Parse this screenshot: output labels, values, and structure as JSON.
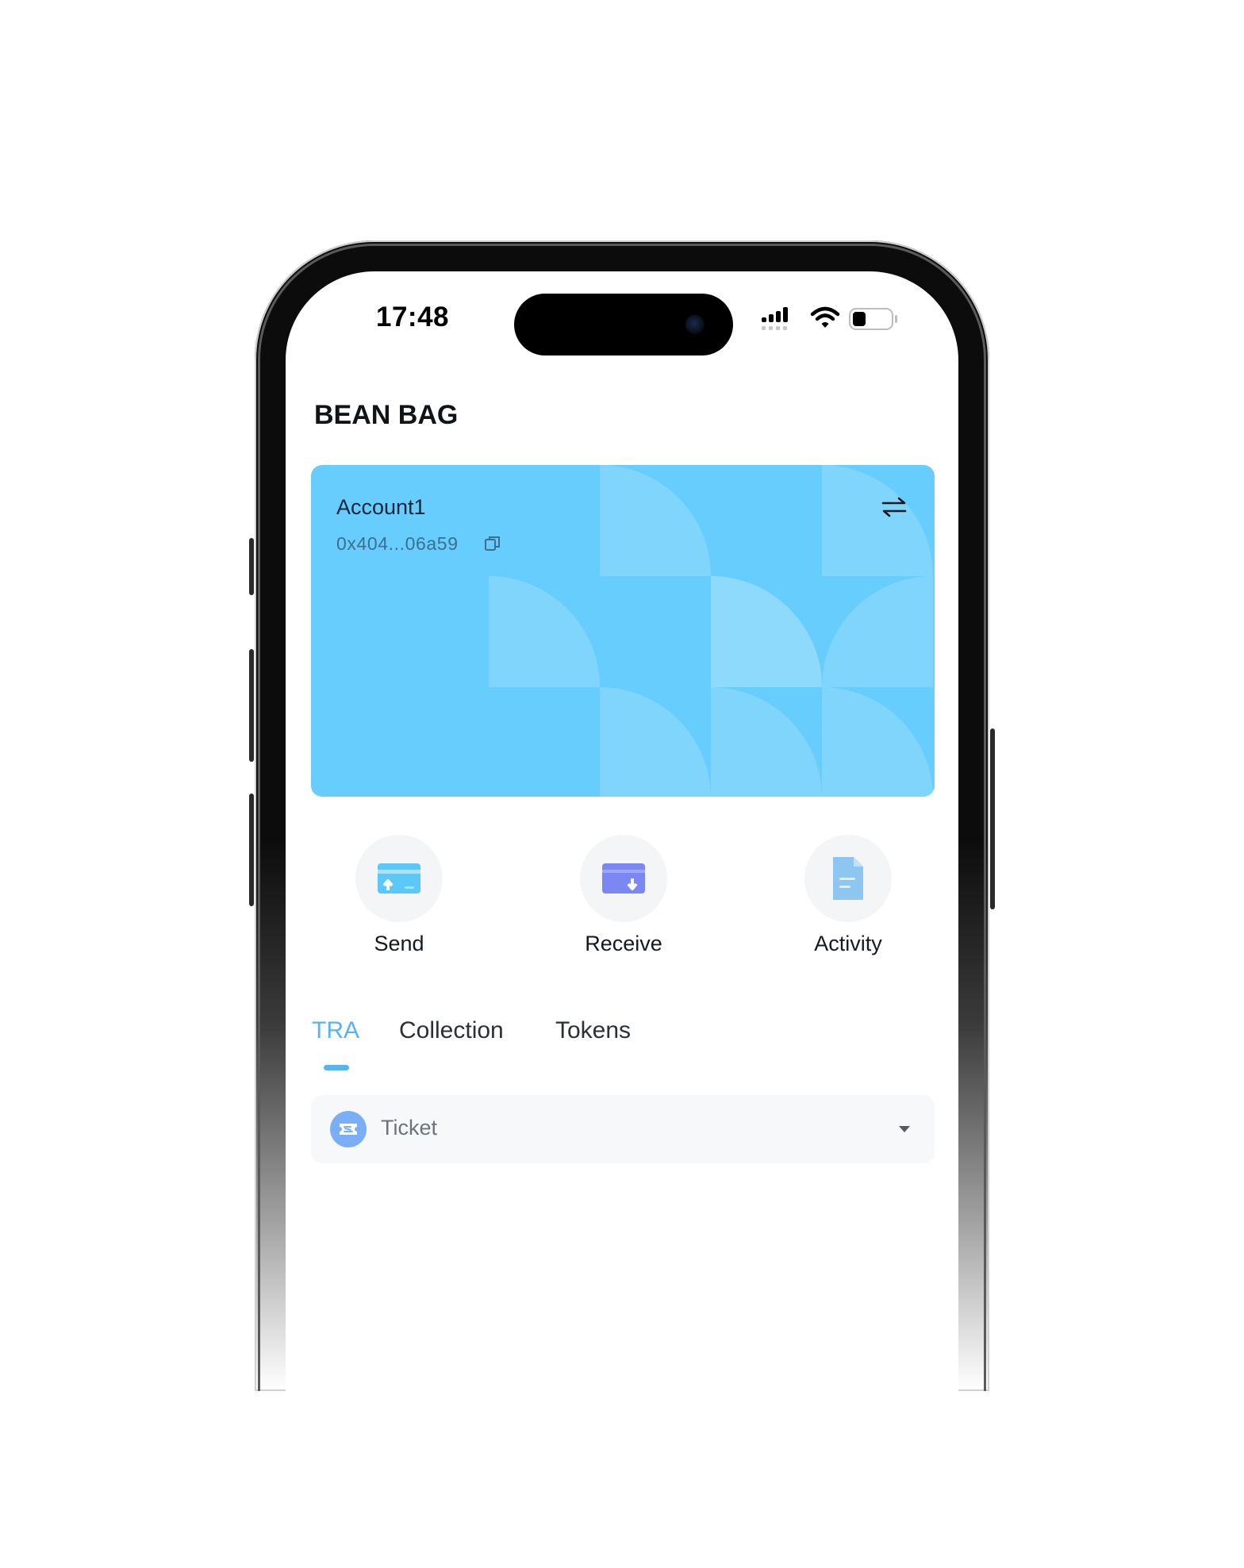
{
  "status_bar": {
    "time": "17:48"
  },
  "app": {
    "title": "BEAN BAG"
  },
  "account_card": {
    "name": "Account1",
    "address": "0x404...06a59",
    "background_color": "#66cdfd"
  },
  "actions": [
    {
      "label": "Send",
      "icon": "send-card-icon",
      "color": "#5cc8f7"
    },
    {
      "label": "Receive",
      "icon": "receive-card-icon",
      "color": "#7b88f3"
    },
    {
      "label": "Activity",
      "icon": "document-icon",
      "color": "#8ec6f2"
    }
  ],
  "tabs": [
    {
      "label": "TRA",
      "active": true
    },
    {
      "label": "Collection",
      "active": false
    },
    {
      "label": "Tokens",
      "active": false
    }
  ],
  "accent_color": "#56b4f5",
  "token_selector": {
    "label": "Ticket",
    "icon": "ticket-icon"
  }
}
